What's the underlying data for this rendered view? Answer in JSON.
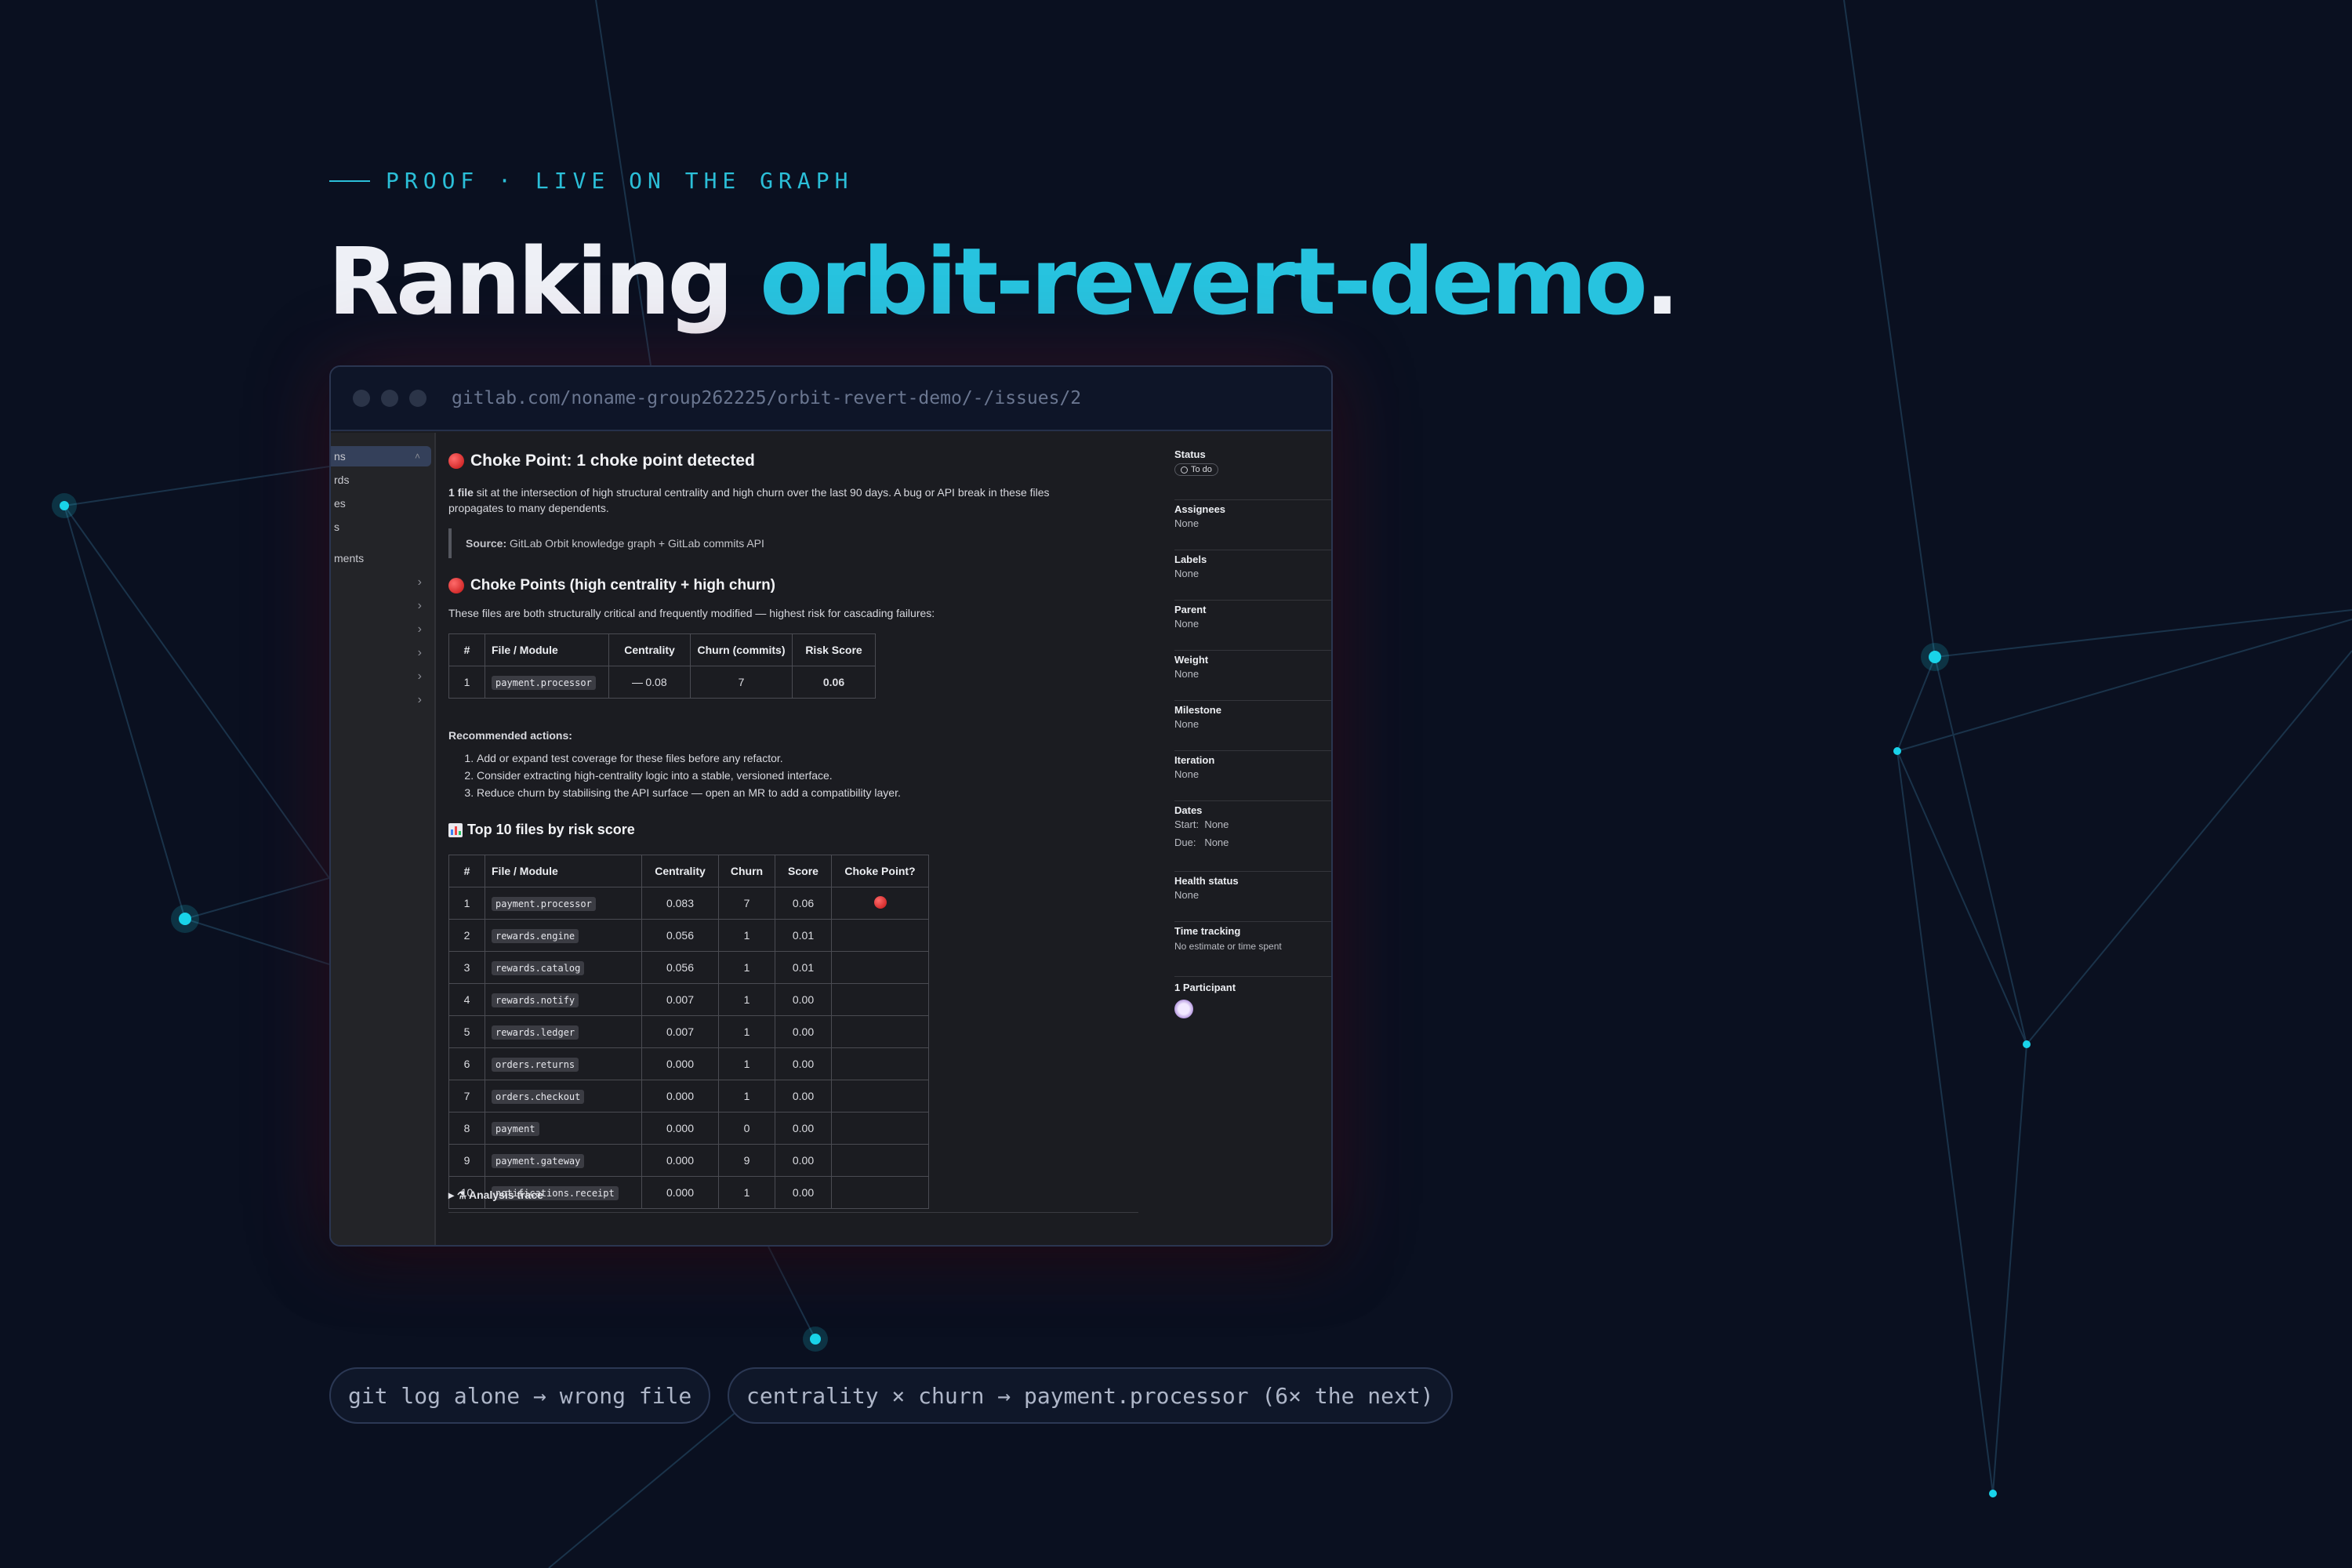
{
  "eyebrow": "PROOF · LIVE ON THE GRAPH",
  "headline": {
    "lead": "Ranking",
    "accent": "orbit-revert-demo",
    "period": "."
  },
  "browser": {
    "url": "gitlab.com/noname-group262225/orbit-revert-demo/-/issues/2"
  },
  "sidebar": {
    "items": [
      "ns",
      "rds",
      "es",
      "s",
      "ments"
    ]
  },
  "issue": {
    "heading": "Choke Point: 1 choke point detected",
    "summary_bold": "1 file",
    "summary_line1": "sit at the intersection of high structural centrality and high churn over the last 90 days. A bug or API break in these files",
    "summary_line2": "propagates to many dependents.",
    "source_label": "Source:",
    "source_text": "GitLab Orbit knowledge graph + GitLab commits API",
    "choke_heading": "Choke Points (high centrality + high churn)",
    "choke_desc": "These files are both structurally critical and frequently modified — highest risk for cascading failures:",
    "choke_table": {
      "headers": [
        "#",
        "File / Module",
        "Centrality",
        "Churn (commits)",
        "Risk Score"
      ],
      "rows": [
        [
          "1",
          "payment.processor",
          "0.08",
          "7",
          "0.06"
        ]
      ]
    },
    "recs_title": "Recommended actions:",
    "recs": [
      "Add or expand test coverage for these files before any refactor.",
      "Consider extracting high-centrality logic into a stable, versioned interface.",
      "Reduce churn by stabilising the API surface — open an MR to add a compatibility layer."
    ],
    "top_heading": "Top 10 files by risk score",
    "top_table": {
      "headers": [
        "#",
        "File / Module",
        "Centrality",
        "Churn",
        "Score",
        "Choke Point?"
      ],
      "rows": [
        [
          "1",
          "payment.processor",
          "0.083",
          "7",
          "0.06",
          "red"
        ],
        [
          "2",
          "rewards.engine",
          "0.056",
          "1",
          "0.01",
          ""
        ],
        [
          "3",
          "rewards.catalog",
          "0.056",
          "1",
          "0.01",
          ""
        ],
        [
          "4",
          "rewards.notify",
          "0.007",
          "1",
          "0.00",
          ""
        ],
        [
          "5",
          "rewards.ledger",
          "0.007",
          "1",
          "0.00",
          ""
        ],
        [
          "6",
          "orders.returns",
          "0.000",
          "1",
          "0.00",
          ""
        ],
        [
          "7",
          "orders.checkout",
          "0.000",
          "1",
          "0.00",
          ""
        ],
        [
          "8",
          "payment",
          "0.000",
          "0",
          "0.00",
          ""
        ],
        [
          "9",
          "payment.gateway",
          "0.000",
          "9",
          "0.00",
          ""
        ],
        [
          "10",
          "notifications.receipt",
          "0.000",
          "1",
          "0.00",
          ""
        ]
      ]
    },
    "trace": "Analysis trace"
  },
  "rail": {
    "status": {
      "label": "Status",
      "value": "To do"
    },
    "assignees": {
      "label": "Assignees",
      "value": "None"
    },
    "labels": {
      "label": "Labels",
      "value": "None"
    },
    "parent": {
      "label": "Parent",
      "value": "None"
    },
    "weight": {
      "label": "Weight",
      "value": "None"
    },
    "milestone": {
      "label": "Milestone",
      "value": "None"
    },
    "iteration": {
      "label": "Iteration",
      "value": "None"
    },
    "dates": {
      "label": "Dates",
      "start_label": "Start:",
      "start": "None",
      "due_label": "Due:",
      "due": "None"
    },
    "health": {
      "label": "Health status",
      "value": "None"
    },
    "time": {
      "label": "Time tracking",
      "value": "No estimate or time spent"
    },
    "participants": {
      "label": "1 Participant"
    }
  },
  "pills": [
    "git log alone → wrong file",
    "centrality × churn → payment.processor (6× the next)"
  ],
  "colors": {
    "accent": "#27c3df",
    "background": "#0a1020",
    "choke_red": "#d61f1f"
  }
}
